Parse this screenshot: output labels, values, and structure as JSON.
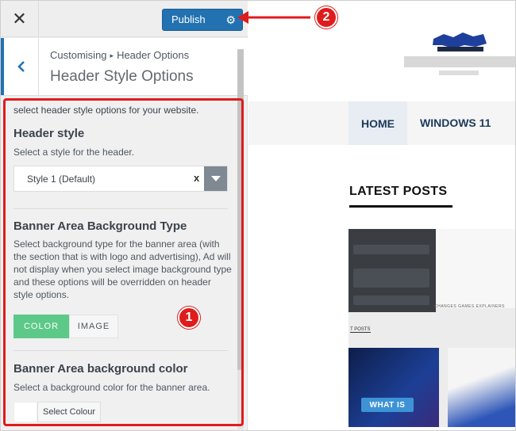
{
  "topbar": {
    "close_icon": "close-icon",
    "publish_label": "Publish",
    "gear_icon": "gear-icon"
  },
  "section": {
    "back_icon": "chevron-left-icon",
    "breadcrumb_parent": "Customising",
    "breadcrumb_child": "Header Options",
    "title": "Header Style Options"
  },
  "panel": {
    "intro": "select header style options for your website.",
    "header_style": {
      "title": "Header style",
      "description": "Select a style for the header.",
      "selected": "Style 1 (Default)",
      "clear": "x"
    },
    "banner_type": {
      "title": "Banner Area Background Type",
      "description": "Select background type for the banner area (with the section that is with logo and advertising), Ad will not display when you select image background type and these options will be overridden on header style options.",
      "options": [
        "COLOR",
        "IMAGE"
      ],
      "selected": "COLOR"
    },
    "banner_color": {
      "title": "Banner Area background color",
      "description": "Select a background color for the banner area.",
      "button": "Select Colour"
    }
  },
  "annotations": {
    "badge1": "1",
    "badge2": "2",
    "accent": "#e01b1b"
  },
  "preview": {
    "nav": [
      "HOME",
      "WINDOWS 11"
    ],
    "latest_posts": "LATEST POSTS",
    "thumb_posts_label": "T POSTS",
    "thumb_tabs": "CHANGES   GAMES   EXPLAINERS",
    "card_button": "WHAT IS"
  },
  "colors": {
    "wp_blue": "#2271b1",
    "toggle_green": "#5dc988",
    "nav_text": "#1b3a5c"
  }
}
